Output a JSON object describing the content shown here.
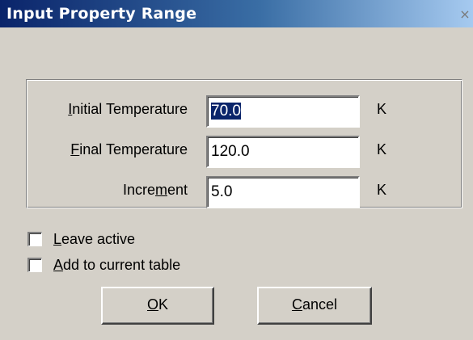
{
  "window": {
    "title": "Input Property Range",
    "close_glyph": "×"
  },
  "fields": [
    {
      "label_pre": "",
      "label_key": "I",
      "label_post": "nitial Temperature",
      "value": "70.0",
      "unit": "K",
      "selected": true
    },
    {
      "label_pre": "",
      "label_key": "F",
      "label_post": "inal Temperature",
      "value": "120.0",
      "unit": "K",
      "selected": false
    },
    {
      "label_pre": "Incre",
      "label_key": "m",
      "label_post": "ent",
      "value": "5.0",
      "unit": "K",
      "selected": false
    }
  ],
  "checkboxes": [
    {
      "pre": "",
      "key": "L",
      "post": "eave active",
      "checked": false
    },
    {
      "pre": "",
      "key": "A",
      "post": "dd to current table",
      "checked": false
    }
  ],
  "buttons": {
    "ok": {
      "key": "O",
      "post": "K"
    },
    "cancel": {
      "key": "C",
      "post": "ancel"
    }
  }
}
